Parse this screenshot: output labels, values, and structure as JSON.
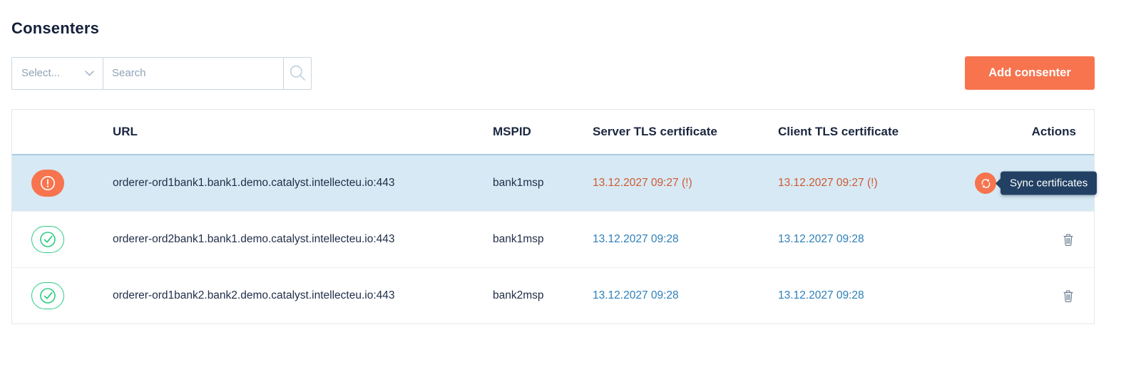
{
  "page": {
    "title": "Consenters"
  },
  "filters": {
    "select_placeholder": "Select...",
    "search_placeholder": "Search"
  },
  "toolbar": {
    "add_consenter_label": "Add consenter"
  },
  "table": {
    "columns": [
      "URL",
      "MSPID",
      "Server TLS certificate",
      "Client TLS certificate",
      "Actions"
    ],
    "rows": [
      {
        "status": "warning",
        "selected": true,
        "url": "orderer-ord1bank1.bank1.demo.catalyst.intellecteu.io:443",
        "mspid": "bank1msp",
        "server_tls_certificate": "13.12.2027 09:27 (!)",
        "client_tls_certificate": "13.12.2027 09:27 (!)",
        "tooltip": "Sync certificates"
      },
      {
        "status": "ok",
        "selected": false,
        "url": "orderer-ord2bank1.bank1.demo.catalyst.intellecteu.io:443",
        "mspid": "bank1msp",
        "server_tls_certificate": "13.12.2027 09:28",
        "client_tls_certificate": "13.12.2027 09:28"
      },
      {
        "status": "ok",
        "selected": false,
        "url": "orderer-ord1bank2.bank2.demo.catalyst.intellecteu.io:443",
        "mspid": "bank2msp",
        "server_tls_certificate": "13.12.2027 09:28",
        "client_tls_certificate": "13.12.2027 09:28"
      }
    ]
  },
  "icons": {
    "select_chevron": "chevron-down",
    "search": "magnifier",
    "status_warning": "exclamation-circle",
    "status_ok": "check-circle",
    "sync": "refresh-arrows",
    "delete": "trash-can"
  },
  "colors": {
    "accent_orange": "#f7744e",
    "warning_text": "#cd5a32",
    "link_blue": "#2d7fb8",
    "success_green": "#2ecc81",
    "selected_row_bg": "#d7e9f4",
    "tooltip_bg": "#224063",
    "title_text": "#15203a"
  }
}
